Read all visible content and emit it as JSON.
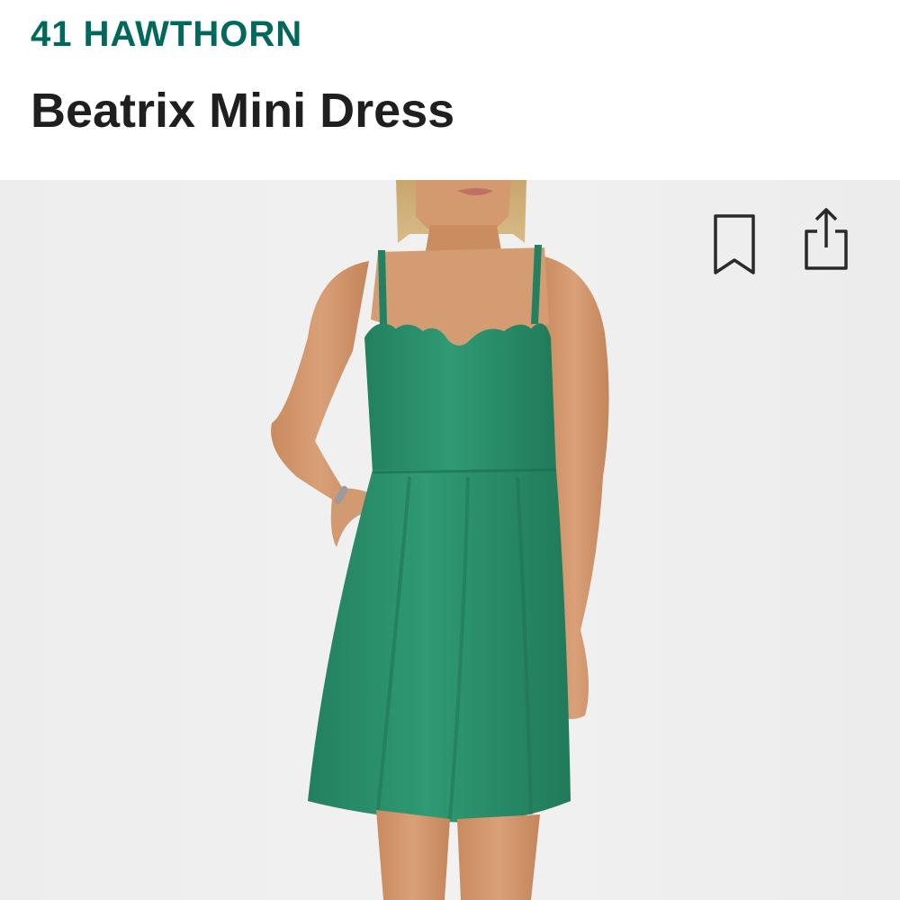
{
  "header": {
    "brand": "41 HAWTHORN",
    "product_title": "Beatrix Mini Dress"
  },
  "image": {
    "description_alt": "",
    "dress_color": "#2b9471",
    "background_color": "#ededed"
  },
  "actions": {
    "save_icon": "bookmark-icon",
    "share_icon": "share-icon"
  },
  "colors": {
    "brand": "#00695c",
    "title": "#1f1f1f",
    "icon": "#2a2a2a"
  }
}
